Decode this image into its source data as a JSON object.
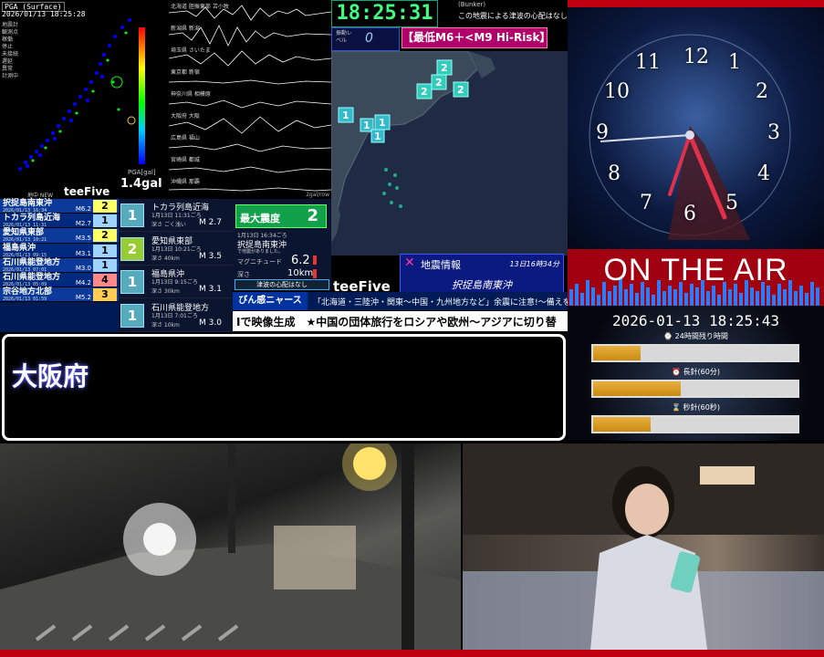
{
  "pga_panel": {
    "timestamp": "PGA (Surface)",
    "datetime": "2026/01/13 18:25:28",
    "legend_lines": [
      "地震計",
      "観測点",
      "稼働",
      "停止",
      "未接続",
      "遅延",
      "異常",
      "計測中"
    ],
    "pga_label": "PGA[gal]",
    "scale_min_label": "1.4gal",
    "gal_value": "1.4gal",
    "brand": "teeFive",
    "new_tag": "地中 NEW"
  },
  "waveforms": {
    "stations": [
      "北海道 胆振東部 苫小牧",
      "新潟県 新潟",
      "埼玉県 さいたま",
      "東京都 新宿",
      "神奈川県 相模原",
      "大阪府 大阪",
      "広島県 福山",
      "宮崎県 都城",
      "沖縄県 那覇"
    ],
    "unit": "2gal/row"
  },
  "top_clock": "18:25:31",
  "tsunami_note": {
    "line1": "(Bunker)",
    "line2": "この地震による津波の心配はなし"
  },
  "level": {
    "label": "振動レベル",
    "value": "0"
  },
  "risk_badge": "【最低M6＋<M9 Hi-Risk】",
  "map_brand": "teeFive",
  "quake_list": [
    {
      "name": "択捉島南東沖",
      "date": "2026/01/13 16:34",
      "mag": "M6.2",
      "intensity": "2",
      "color": "#ffff66"
    },
    {
      "name": "トカラ列島近海",
      "date": "2026/01/13 11:31",
      "mag": "M2.7",
      "intensity": "1",
      "color": "#9fd3ff"
    },
    {
      "name": "愛知県東部",
      "date": "2026/01/13 10:21",
      "mag": "M3.5",
      "intensity": "2",
      "color": "#ffff66"
    },
    {
      "name": "福島県沖",
      "date": "2026/01/13 09:15",
      "mag": "M3.1",
      "intensity": "1",
      "color": "#9fd3ff"
    },
    {
      "name": "石川県能登地方",
      "date": "2026/01/13 07:01",
      "mag": "M3.0",
      "intensity": "1",
      "color": "#9fd3ff"
    },
    {
      "name": "石川県能登地方",
      "date": "2026/01/13 05:09",
      "mag": "M4.2",
      "intensity": "4",
      "color": "#ff8888"
    },
    {
      "name": "宗谷地方北部",
      "date": "2026/01/13 01:59",
      "mag": "M5.2",
      "intensity": "3",
      "color": "#ffcc55"
    }
  ],
  "quake_detail": [
    {
      "place": "トカラ列島近海",
      "time": "1月13日 11:31ごろ",
      "depth": "深さ ごく浅い",
      "mag": "M 2.7",
      "intensity": "1"
    },
    {
      "place": "愛知県東部",
      "time": "1月13日 10:21ごろ",
      "depth": "深さ 40km",
      "mag": "M 3.5",
      "intensity": "2"
    },
    {
      "place": "福島県沖",
      "time": "1月13日 9:15ごろ",
      "depth": "深さ 30km",
      "mag": "M 3.1",
      "intensity": "1"
    },
    {
      "place": "石川県能登地方",
      "time": "1月13日 7:01ごろ",
      "depth": "深さ 10km",
      "mag": "M 3.0",
      "intensity": "1"
    }
  ],
  "max_intensity": {
    "title": "最大震度",
    "value": "2",
    "time": "1月13日 16:34ごろ",
    "location": "択捉島南東沖",
    "note": "で地震がありました。",
    "mag_label": "マグニチュード",
    "mag_value": "6.2",
    "depth_label": "深さ",
    "depth_value": "10km",
    "tsunami": "津波の心配はなし"
  },
  "eq_info": {
    "icon": "✕",
    "title": "地震情報",
    "date": "13日16時34分",
    "place": "択捉島南東沖"
  },
  "ticker1": {
    "label": "びん感ニャース",
    "text": "「北海道・三陸沖・関東〜中国・九州地方など」余震に注意!〜備えを〜"
  },
  "ticker2": {
    "text": "Iで映像生成　★中国の団体旅行をロシアや欧州〜アジアに切り替"
  },
  "clock_numbers": [
    "12",
    "1",
    "2",
    "3",
    "4",
    "5",
    "6",
    "7",
    "8",
    "9",
    "10",
    "11"
  ],
  "on_air": "ON THE AIR",
  "datetime_panel": {
    "datetime": "2026-01-13 18:25:43",
    "label1": "⌚ 24時間残り時間",
    "label2": "⏰ 長針(60分)",
    "label3": "⌛ 秒針(60秒)",
    "progress_24h": 0.23,
    "progress_min": 0.43,
    "progress_sec": 0.28
  },
  "location_banner": "大阪府",
  "colors": {
    "accent_red": "#c00010",
    "clock_green": "#3fff7f",
    "risk_magenta": "#b0006a"
  }
}
